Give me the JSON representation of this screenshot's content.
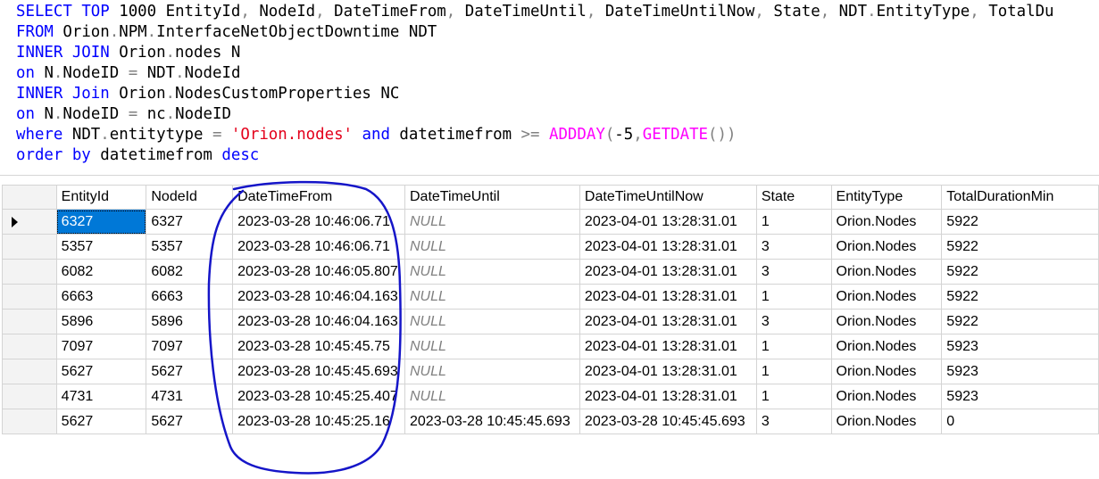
{
  "query": {
    "line1": {
      "select": "SELECT",
      "top": "TOP",
      "n": "1000",
      "c1": "EntityId",
      "c2": "NodeId",
      "c3": "DateTimeFrom",
      "c4": "DateTimeUntil",
      "c5": "DateTimeUntilNow",
      "c6": "State",
      "c7a": "NDT",
      "c7b": "EntityType",
      "c8": "TotalDu"
    },
    "line2": {
      "from": "FROM",
      "o": "Orion",
      "npm": "NPM",
      "tbl": "InterfaceNetObjectDowntime",
      "alias": "NDT"
    },
    "line3": {
      "kw": "INNER JOIN",
      "o": "Orion",
      "tbl": "nodes",
      "alias": "N"
    },
    "line4": {
      "on": "on",
      "a": "N",
      "b": "NodeID",
      "c": "NDT",
      "d": "NodeId"
    },
    "line5": {
      "kw": "INNER Join",
      "o": "Orion",
      "tbl": "NodesCustomProperties",
      "alias": "NC"
    },
    "line6": {
      "on": "on",
      "a": "N",
      "b": "NodeID",
      "c": "nc",
      "d": "NodeID"
    },
    "line7": {
      "where": "where",
      "a": "NDT",
      "b": "entitytype",
      "str": "'Orion.nodes'",
      "and": "and",
      "col": "datetimefrom",
      "fn1": "ADDDAY",
      "num": "-5",
      "fn2": "GETDATE"
    },
    "line8": {
      "order": "order by",
      "col": "datetimefrom",
      "desc": "desc"
    }
  },
  "results": {
    "columns": [
      "EntityId",
      "NodeId",
      "DateTimeFrom",
      "DateTimeUntil",
      "DateTimeUntilNow",
      "State",
      "EntityType",
      "TotalDurationMin"
    ],
    "rows": [
      [
        "6327",
        "6327",
        "2023-03-28 10:46:06.71",
        "NULL",
        "2023-04-01 13:28:31.01",
        "1",
        "Orion.Nodes",
        "5922"
      ],
      [
        "5357",
        "5357",
        "2023-03-28 10:46:06.71",
        "NULL",
        "2023-04-01 13:28:31.01",
        "3",
        "Orion.Nodes",
        "5922"
      ],
      [
        "6082",
        "6082",
        "2023-03-28 10:46:05.807",
        "NULL",
        "2023-04-01 13:28:31.01",
        "3",
        "Orion.Nodes",
        "5922"
      ],
      [
        "6663",
        "6663",
        "2023-03-28 10:46:04.163",
        "NULL",
        "2023-04-01 13:28:31.01",
        "1",
        "Orion.Nodes",
        "5922"
      ],
      [
        "5896",
        "5896",
        "2023-03-28 10:46:04.163",
        "NULL",
        "2023-04-01 13:28:31.01",
        "3",
        "Orion.Nodes",
        "5922"
      ],
      [
        "7097",
        "7097",
        "2023-03-28 10:45:45.75",
        "NULL",
        "2023-04-01 13:28:31.01",
        "1",
        "Orion.Nodes",
        "5923"
      ],
      [
        "5627",
        "5627",
        "2023-03-28 10:45:45.693",
        "NULL",
        "2023-04-01 13:28:31.01",
        "1",
        "Orion.Nodes",
        "5923"
      ],
      [
        "4731",
        "4731",
        "2023-03-28 10:45:25.407",
        "NULL",
        "2023-04-01 13:28:31.01",
        "1",
        "Orion.Nodes",
        "5923"
      ],
      [
        "5627",
        "5627",
        "2023-03-28 10:45:25.16",
        "2023-03-28 10:45:45.693",
        "2023-03-28 10:45:45.693",
        "3",
        "Orion.Nodes",
        "0"
      ]
    ],
    "selected_row": 0,
    "null_text": "NULL"
  },
  "colors": {
    "keyword": "#0000ff",
    "string": "#e3001b",
    "function": "#ff00ff",
    "operator": "#808080",
    "selection": "#0078d7",
    "annotation": "#1515c8"
  }
}
